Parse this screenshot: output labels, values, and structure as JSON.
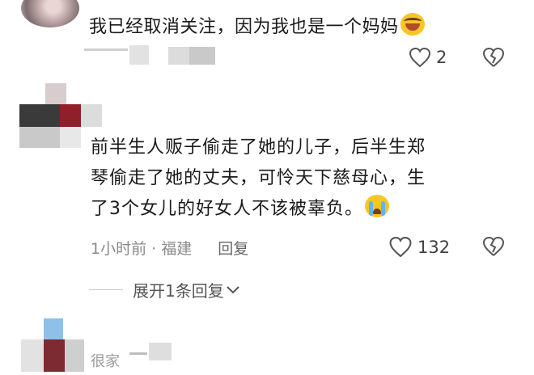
{
  "comments": [
    {
      "text": "我已经取消关注，因为我也是一个妈妈",
      "emoji": "laughing-crying-emoji",
      "likes": "2"
    },
    {
      "lines": [
        "前半生人贩子偷走了她的儿子，后半生郑",
        "琴偷走了她的丈夫，可怜天下慈母心，生",
        "了3个女儿的好女人不该被辜负。"
      ],
      "emoji": "crying-emoji",
      "meta": "1小时前 · 福建",
      "reply_label": "回复",
      "likes": "132",
      "expand_label": "展开1条回复"
    },
    {
      "username": "很家"
    }
  ],
  "colors": {
    "text": "#1a1a1a",
    "meta": "#8a8a8a",
    "icon": "#555555"
  }
}
